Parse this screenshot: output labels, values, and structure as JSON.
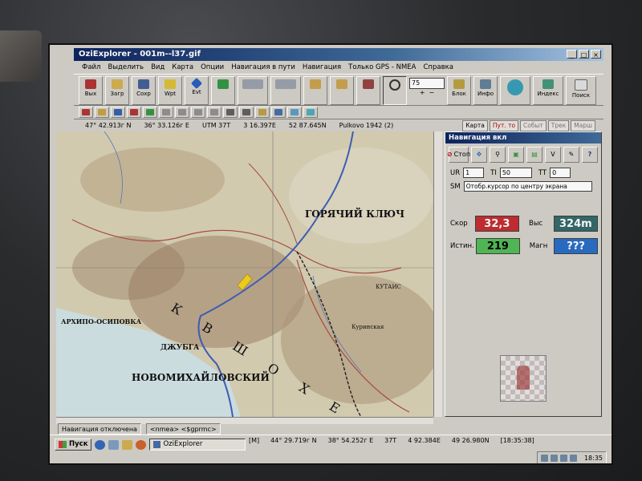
{
  "window": {
    "title": "OziExplorer - 001m--l37.gif",
    "btn_min": "_",
    "btn_max": "□",
    "btn_close": "×"
  },
  "menu": [
    "Файл",
    "Выделить",
    "Вид",
    "Карта",
    "Опции",
    "Навигация в пути",
    "Навигация",
    "Только GPS - NMEA",
    "Справка"
  ],
  "toolbar": {
    "exit": "Вых",
    "load": "Загр",
    "save": "Сохр",
    "wpt": "Wpt",
    "evt": "Evt",
    "zoom_value": "75",
    "block": "Блок",
    "info": "Инфо",
    "index": "Индекс",
    "search": "Поиск"
  },
  "coords": {
    "lat": "47° 42.913г N",
    "lon": "36° 33.126г E",
    "utm": "UTM 37T",
    "easting": "3 16.397E",
    "northing": "52 87.645N",
    "datum": "Pulkovo 1942 (2)"
  },
  "side_tabs": [
    "Карта",
    "Пут. то",
    "Событ",
    "Трек",
    "Марш"
  ],
  "map_labels": {
    "city_main": "НОВОМИХАЙЛОВСКИЙ",
    "town_goryachy": "ГОРЯЧИЙ КЛЮЧ",
    "dzhubga": "ДЖУБГА",
    "arhipo": "АРХИПО-ОСИПОВКА",
    "mountains": "К В Ш О Х Е",
    "kutais": "КУТАИС",
    "kurinskaya": "Куринская"
  },
  "nav_panel": {
    "title": "Навигация вкл",
    "stop_label": "Стоп",
    "v_label": "V",
    "help": "?",
    "ur_label": "UR",
    "ur_val": "1",
    "ti_label": "TI",
    "ti_val": "50",
    "tt_label": "TT",
    "tt_val": "0",
    "sm_label": "SM",
    "sm_val": "Отобр.курсор по центру экрана",
    "speed_label": "Скор",
    "speed_val": "32,3",
    "alt_label": "Выс",
    "alt_val": "324m",
    "true_label": "Истин.",
    "true_val": "219",
    "mag_label": "Магн",
    "mag_val": "???"
  },
  "status": {
    "nav_state": "Навигация отключена",
    "nmea": "<nmea> <$gprmc>"
  },
  "taskbar": {
    "start": "Пуск",
    "app": "OziExplorer",
    "mode": "[M]",
    "lat": "44° 29.719г N",
    "lon": "38° 54.252г E",
    "zone": "37T",
    "easting": "4 92.384E",
    "northing": "49 26.980N",
    "time_bracket": "[18:35:38]",
    "clock": "18:35"
  },
  "colors": {
    "speed_bg": "#d9282b",
    "alt_bg": "#2d6b6b",
    "true_bg": "#45c04a",
    "mag_bg": "#1f6fd6"
  }
}
